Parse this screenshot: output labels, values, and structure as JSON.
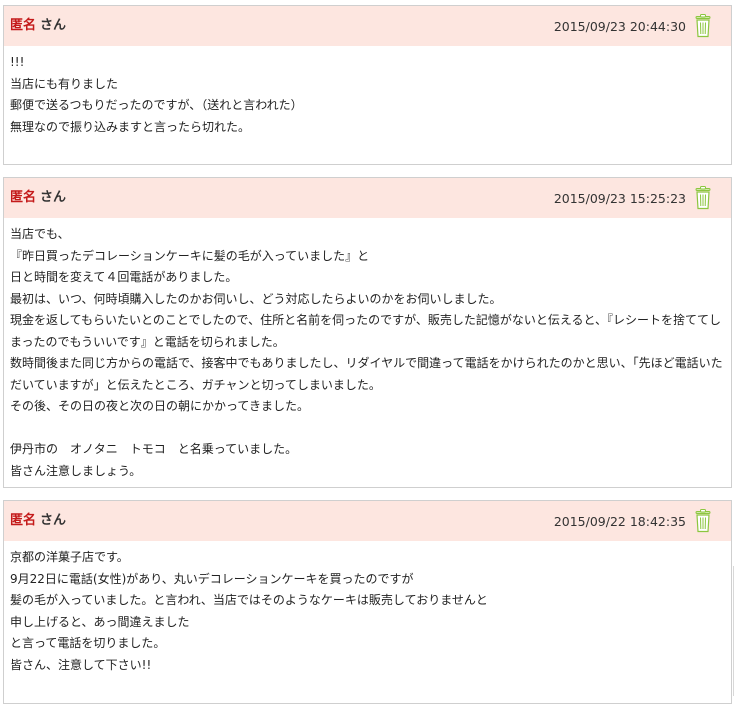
{
  "posts": [
    {
      "author": "匿名",
      "suffix": "さん",
      "timestamp": "2015/09/23 20:44:30",
      "icon": "trash-icon",
      "lines": [
        "!!!",
        "当店にも有りました",
        "郵便で送るつもりだったのですが、（送れと言われた）",
        "無理なので振り込みますと言ったら切れた。"
      ]
    },
    {
      "author": "匿名",
      "suffix": "さん",
      "timestamp": "2015/09/23 15:25:23",
      "icon": "trash-icon",
      "lines": [
        "当店でも、",
        "『昨日買ったデコレーションケーキに髪の毛が入っていました』と",
        "日と時間を変えて４回電話がありました。",
        "最初は、いつ、何時頃購入したのかお伺いし、どう対応したらよいのかをお伺いしました。",
        "現金を返してもらいたいとのことでしたので、住所と名前を伺ったのですが、販売した記憶がないと伝えると、『レシートを捨ててしまったのでもういいです』と電話を切られました。",
        "数時間後また同じ方からの電話で、接客中でもありましたし、リダイヤルで間違って電話をかけられたのかと思い、「先ほど電話いただいていますが」と伝えたところ、ガチャンと切ってしまいました。",
        "その後、その日の夜と次の日の朝にかかってきました。",
        "",
        "伊丹市の　オノタニ　トモコ　と名乗っていました。",
        "皆さん注意しましょう。"
      ]
    },
    {
      "author": "匿名",
      "suffix": "さん",
      "timestamp": "2015/09/22 18:42:35",
      "icon": "trash-icon",
      "lines": [
        "京都の洋菓子店です。",
        "9月22日に電話(女性)があり、丸いデコレーションケーキを買ったのですが",
        "髪の毛が入っていました。と言われ、当店ではそのようなケーキは販売しておりませんと",
        "申し上げると、あっ間違えました",
        "と言って電話を切りました。",
        "皆さん、注意して下さい!!"
      ]
    }
  ],
  "colors": {
    "header_bg": "#fde6e0",
    "author": "#c41a1a",
    "border": "#cfcfcf",
    "trash_green": "#8cc63f"
  }
}
